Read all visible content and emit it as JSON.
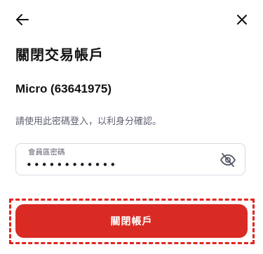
{
  "header": {
    "back_icon": "arrow-left-icon",
    "close_icon": "close-icon",
    "title": "關閉交易帳戶"
  },
  "account": {
    "label": "Micro (63641975)"
  },
  "instruction": "請使用此密碼登入，以利身分確認。",
  "password_field": {
    "label": "會員區密碼",
    "value": "••••••••••••",
    "toggle_icon": "eye-off-icon"
  },
  "actions": {
    "close_account_label": "關閉帳戶"
  },
  "colors": {
    "primary": "#d92b24",
    "highlight": "#e0261f",
    "muted_text": "#5e6170",
    "border": "#d9dbe3"
  }
}
